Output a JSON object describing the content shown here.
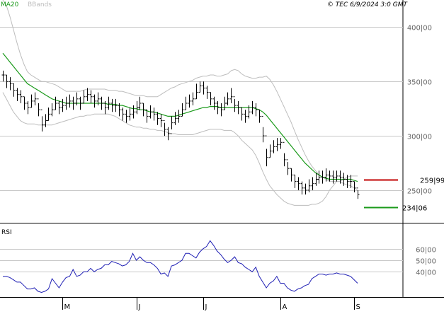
{
  "header": {
    "legend_ma": "MA20",
    "legend_bb": "BBands",
    "copyright": "© TEC 6/9/2024 3:0 GMT"
  },
  "colors": {
    "ma": "#1a9a1a",
    "bbands": "#bdbdbd",
    "price_bar": "#000000",
    "rsi": "#1f1fb4",
    "resistance": "#c00000",
    "support": "#1a9a1a",
    "grid": "#c8c8c8",
    "axis": "#000000",
    "tick_text": "#666666"
  },
  "chart_data": [
    {
      "type": "ohlc",
      "name": "price",
      "ylim": [
        220,
        425
      ],
      "y_ticks": [
        {
          "value": 250,
          "label": "250|00"
        },
        {
          "value": 300,
          "label": "300|00"
        },
        {
          "value": 350,
          "label": "350|00"
        },
        {
          "value": 400,
          "label": "400|00"
        }
      ],
      "x_range": [
        0,
        102
      ],
      "x_ticks": [
        {
          "x": 17,
          "label": "M"
        },
        {
          "x": 38,
          "label": "J"
        },
        {
          "x": 57,
          "label": "J"
        },
        {
          "x": 79,
          "label": "A"
        },
        {
          "x": 100,
          "label": "S"
        }
      ],
      "close": [
        356,
        350,
        348,
        342,
        338,
        336,
        330,
        326,
        332,
        334,
        324,
        310,
        314,
        320,
        324,
        330,
        326,
        328,
        330,
        332,
        330,
        334,
        330,
        336,
        338,
        336,
        332,
        334,
        330,
        326,
        330,
        328,
        328,
        324,
        320,
        318,
        320,
        322,
        326,
        330,
        324,
        318,
        322,
        320,
        316,
        314,
        306,
        302,
        312,
        316,
        318,
        324,
        330,
        332,
        334,
        340,
        346,
        344,
        340,
        334,
        330,
        326,
        324,
        330,
        334,
        336,
        328,
        326,
        320,
        318,
        322,
        326,
        324,
        318,
        300,
        280,
        286,
        290,
        292,
        294,
        278,
        270,
        264,
        258,
        256,
        252,
        250,
        254,
        256,
        260,
        262,
        262,
        264,
        263,
        262,
        263,
        262,
        260,
        258,
        258,
        252,
        246
      ],
      "high": [
        360,
        356,
        354,
        348,
        344,
        342,
        336,
        332,
        338,
        340,
        330,
        318,
        320,
        326,
        330,
        336,
        332,
        334,
        336,
        338,
        336,
        340,
        336,
        342,
        344,
        342,
        338,
        340,
        336,
        332,
        336,
        334,
        334,
        330,
        326,
        324,
        326,
        328,
        332,
        336,
        330,
        324,
        328,
        326,
        322,
        320,
        312,
        308,
        318,
        322,
        324,
        330,
        336,
        338,
        340,
        348,
        350,
        350,
        346,
        340,
        336,
        332,
        330,
        336,
        340,
        344,
        334,
        332,
        326,
        324,
        328,
        332,
        330,
        324,
        308,
        288,
        292,
        296,
        298,
        298,
        284,
        276,
        270,
        264,
        262,
        258,
        256,
        260,
        262,
        266,
        268,
        268,
        270,
        268,
        268,
        268,
        268,
        266,
        264,
        264,
        258,
        250
      ],
      "low": [
        350,
        344,
        342,
        336,
        332,
        330,
        324,
        320,
        326,
        328,
        318,
        304,
        308,
        314,
        318,
        324,
        320,
        322,
        324,
        326,
        324,
        328,
        324,
        330,
        332,
        330,
        326,
        328,
        324,
        320,
        324,
        322,
        322,
        318,
        314,
        312,
        314,
        316,
        320,
        324,
        318,
        312,
        316,
        314,
        310,
        308,
        300,
        296,
        306,
        310,
        312,
        318,
        324,
        326,
        328,
        334,
        340,
        338,
        334,
        328,
        324,
        320,
        318,
        324,
        328,
        330,
        322,
        320,
        314,
        312,
        316,
        320,
        318,
        312,
        294,
        272,
        280,
        284,
        286,
        288,
        272,
        264,
        258,
        252,
        250,
        246,
        246,
        248,
        250,
        254,
        256,
        256,
        258,
        258,
        256,
        258,
        256,
        254,
        252,
        252,
        248,
        242
      ],
      "ma20": [
        376,
        372,
        368,
        364,
        360,
        356,
        352,
        348,
        346,
        344,
        342,
        340,
        338,
        336,
        334,
        333,
        332,
        331,
        330,
        330,
        330,
        330,
        330,
        330,
        330,
        330,
        330,
        330,
        330,
        330,
        329,
        329,
        329,
        328,
        328,
        327,
        326,
        325,
        325,
        324,
        324,
        323,
        322,
        322,
        321,
        320,
        319,
        318,
        318,
        318,
        319,
        320,
        321,
        322,
        323,
        324,
        325,
        326,
        326,
        327,
        327,
        327,
        326,
        326,
        326,
        326,
        326,
        326,
        326,
        326,
        326,
        326,
        325,
        324,
        322,
        319,
        315,
        311,
        307,
        303,
        299,
        295,
        291,
        287,
        283,
        279,
        275,
        272,
        269,
        266,
        264,
        262,
        261,
        260,
        260,
        260,
        260,
        260,
        260,
        260,
        259,
        258
      ],
      "bb_upper": [
        425,
        420,
        410,
        398,
        386,
        375,
        366,
        359,
        356,
        354,
        352,
        350,
        350,
        349,
        348,
        347,
        345,
        343,
        341,
        341,
        341,
        341,
        341,
        342,
        343,
        343,
        343,
        343,
        343,
        343,
        342,
        342,
        342,
        341,
        341,
        340,
        339,
        338,
        337,
        337,
        337,
        336,
        336,
        336,
        336,
        338,
        340,
        342,
        344,
        345,
        347,
        348,
        349,
        350,
        351,
        353,
        354,
        355,
        355,
        356,
        356,
        355,
        355,
        356,
        357,
        360,
        361,
        360,
        357,
        355,
        354,
        353,
        353,
        354,
        354,
        355,
        352,
        347,
        341,
        334,
        327,
        320,
        313,
        305,
        297,
        290,
        283,
        277,
        272,
        268,
        264,
        262,
        260,
        258,
        258,
        258,
        258,
        260,
        262,
        263,
        263,
        263
      ],
      "bb_lower": [
        340,
        334,
        328,
        322,
        318,
        314,
        312,
        311,
        311,
        311,
        310,
        310,
        310,
        310,
        310,
        311,
        312,
        313,
        314,
        315,
        316,
        317,
        318,
        318,
        319,
        319,
        320,
        320,
        320,
        320,
        320,
        319,
        318,
        316,
        314,
        312,
        310,
        309,
        308,
        308,
        307,
        307,
        306,
        306,
        305,
        305,
        304,
        303,
        302,
        302,
        301,
        301,
        301,
        301,
        301,
        302,
        303,
        304,
        305,
        306,
        306,
        306,
        306,
        305,
        305,
        305,
        303,
        300,
        296,
        293,
        290,
        287,
        282,
        275,
        267,
        260,
        254,
        250,
        246,
        243,
        240,
        238,
        237,
        236,
        236,
        236,
        236,
        236,
        237,
        237,
        238,
        240,
        244,
        250,
        254,
        258,
        258,
        256,
        255,
        254,
        252,
        250
      ],
      "annotations": [
        {
          "label": "259|99",
          "value": 259.99,
          "role": "resistance"
        },
        {
          "label": "234|06",
          "value": 234.06,
          "role": "support"
        }
      ]
    },
    {
      "type": "line",
      "name": "rsi",
      "title": "RSI",
      "ylim": [
        18,
        82
      ],
      "y_ticks": [
        {
          "value": 40,
          "label": "40|00"
        },
        {
          "value": 50,
          "label": "50|00"
        },
        {
          "value": 60,
          "label": "60|00"
        }
      ],
      "values": [
        36,
        36,
        35,
        33,
        31,
        31,
        28,
        25,
        25,
        26,
        23,
        22,
        23,
        25,
        34,
        30,
        26,
        31,
        35,
        36,
        42,
        36,
        37,
        40,
        40,
        43,
        40,
        42,
        43,
        46,
        46,
        49,
        48,
        47,
        45,
        46,
        49,
        56,
        50,
        53,
        50,
        48,
        48,
        46,
        43,
        38,
        39,
        36,
        45,
        46,
        48,
        50,
        56,
        56,
        54,
        52,
        57,
        60,
        62,
        67,
        63,
        58,
        55,
        51,
        48,
        50,
        53,
        48,
        47,
        44,
        42,
        40,
        44,
        36,
        31,
        26,
        30,
        32,
        36,
        30,
        30,
        26,
        24,
        23,
        25,
        26,
        28,
        29,
        34,
        36,
        38,
        38,
        37,
        38,
        38,
        39,
        38,
        38,
        37,
        36,
        33,
        30
      ]
    }
  ]
}
